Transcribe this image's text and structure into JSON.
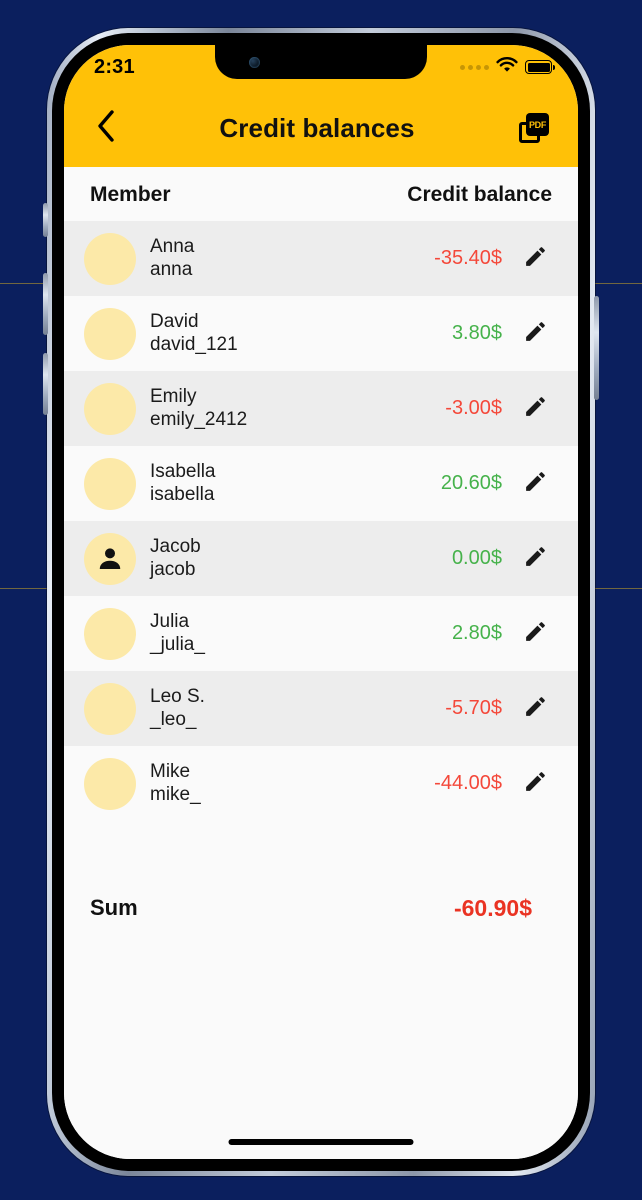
{
  "statusbar": {
    "time": "2:31",
    "signal_icon": "signal-dots-icon",
    "wifi_icon": "wifi-icon",
    "battery_icon": "battery-full-icon"
  },
  "appbar": {
    "back_icon": "chevron-left-icon",
    "title": "Credit balances",
    "pdf_label": "PDF",
    "pdf_icon": "pdf-export-icon"
  },
  "table": {
    "headers": {
      "member": "Member",
      "balance": "Credit balance"
    },
    "rows": [
      {
        "name": "Anna",
        "handle": "anna",
        "amount": "-35.40$",
        "sign": "neg",
        "avatar": "photo",
        "pic": "pic-anna"
      },
      {
        "name": "David",
        "handle": "david_121",
        "amount": "3.80$",
        "sign": "pos",
        "avatar": "photo",
        "pic": "pic-david"
      },
      {
        "name": "Emily",
        "handle": "emily_2412",
        "amount": "-3.00$",
        "sign": "neg",
        "avatar": "photo",
        "pic": "pic-emily"
      },
      {
        "name": "Isabella",
        "handle": "isabella",
        "amount": "20.60$",
        "sign": "pos",
        "avatar": "photo",
        "pic": "pic-isabella"
      },
      {
        "name": "Jacob",
        "handle": "jacob",
        "amount": "0.00$",
        "sign": "pos",
        "avatar": "placeholder",
        "pic": ""
      },
      {
        "name": "Julia",
        "handle": "_julia_",
        "amount": "2.80$",
        "sign": "pos",
        "avatar": "photo",
        "pic": "pic-julia"
      },
      {
        "name": "Leo S.",
        "handle": "_leo_",
        "amount": "-5.70$",
        "sign": "neg",
        "avatar": "photo",
        "pic": "pic-leo"
      },
      {
        "name": "Mike",
        "handle": "mike_",
        "amount": "-44.00$",
        "sign": "neg",
        "avatar": "photo",
        "pic": "pic-mike"
      }
    ],
    "edit_icon": "pencil-edit-icon",
    "avatar_placeholder_icon": "person-icon"
  },
  "summary": {
    "label": "Sum",
    "value": "-60.90$",
    "sign": "neg"
  },
  "colors": {
    "accent_yellow": "#FFC107",
    "negative_red": "#F4483A",
    "positive_green": "#46B24B",
    "sum_red": "#EA3323",
    "row_alt": "#EDEDED",
    "row_plain": "#FAFAFA",
    "backdrop_navy": "#0B1F5E",
    "avatar_placeholder_bg": "#FCE9A8"
  },
  "home_indicator": "home-indicator"
}
